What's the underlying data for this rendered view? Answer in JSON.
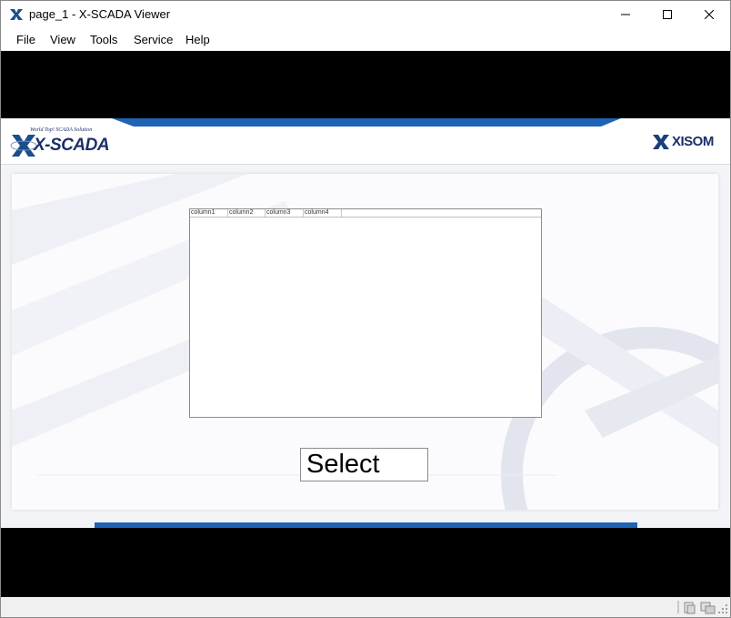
{
  "window": {
    "title": "page_1 - X-SCADA Viewer"
  },
  "menu": {
    "items": [
      "File",
      "View",
      "Tools",
      "Service",
      "Help"
    ]
  },
  "header": {
    "logo_tagline": "World Top! SCADA Solution",
    "logo_text": "X-SCADA",
    "brand_logo_text": "XISOM"
  },
  "grid": {
    "columns": [
      "column1",
      "column2",
      "column3",
      "column4"
    ],
    "rows": []
  },
  "select_button": {
    "label": "Select"
  },
  "colors": {
    "accent_blue": "#1f63b5",
    "logo_navy": "#1b2f6b",
    "background_black": "#000000"
  }
}
